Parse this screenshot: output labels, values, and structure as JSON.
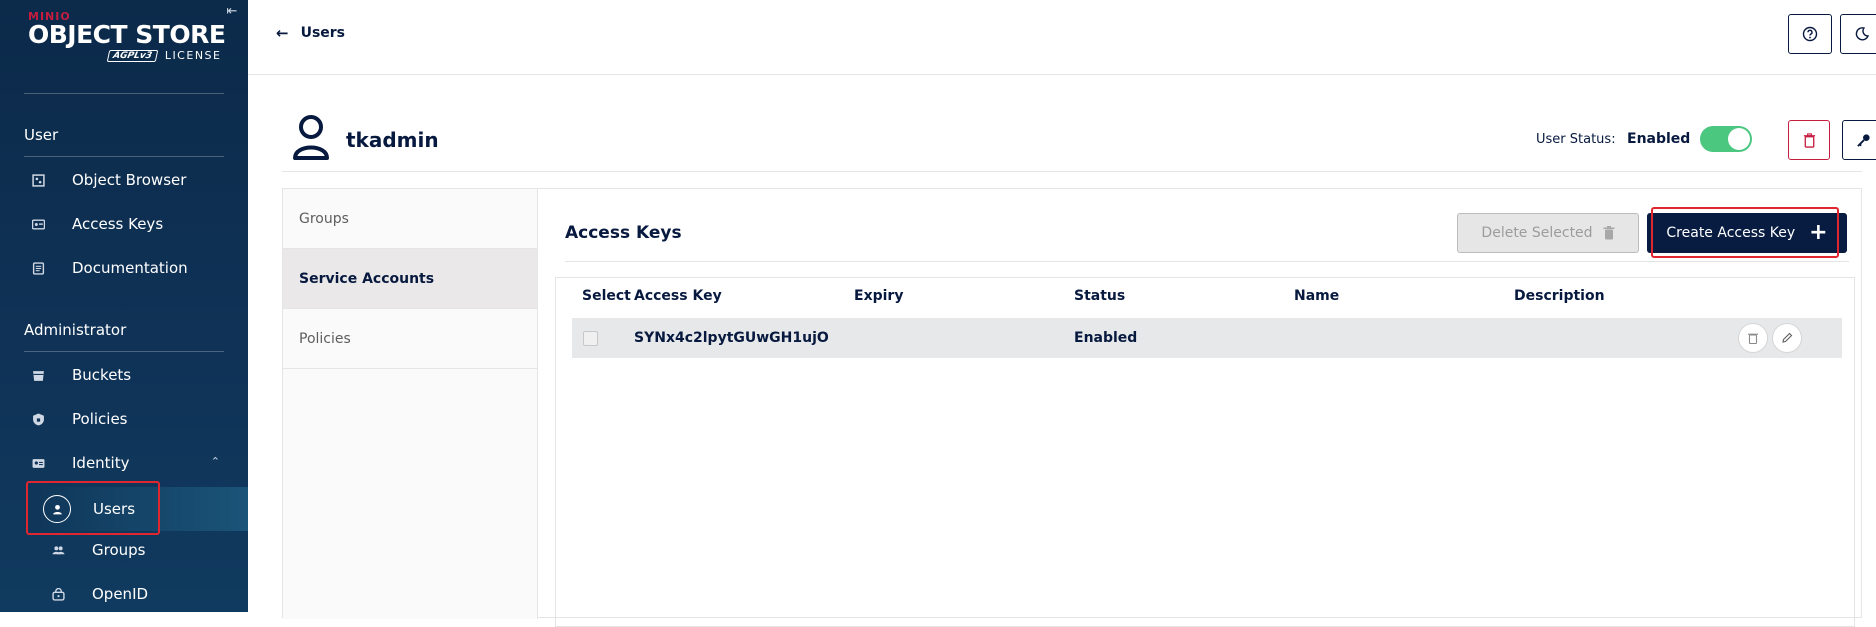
{
  "brand": {
    "logo_top": "MINIO",
    "product": "OBJECT STORE",
    "license_badge": "AGPLv3",
    "license": "LICENSE"
  },
  "sidebar": {
    "user_section": "User",
    "user_items": [
      {
        "label": "Object Browser",
        "icon": "object-browser-icon"
      },
      {
        "label": "Access Keys",
        "icon": "access-keys-icon"
      },
      {
        "label": "Documentation",
        "icon": "documentation-icon"
      }
    ],
    "admin_section": "Administrator",
    "admin_items": [
      {
        "label": "Buckets",
        "icon": "buckets-icon"
      },
      {
        "label": "Policies",
        "icon": "policies-icon"
      },
      {
        "label": "Identity",
        "icon": "identity-icon"
      }
    ],
    "identity_items": [
      {
        "label": "Users",
        "icon": "user-circle-icon",
        "active": true
      },
      {
        "label": "Groups",
        "icon": "groups-icon"
      },
      {
        "label": "OpenID",
        "icon": "openid-icon"
      }
    ]
  },
  "topbar": {
    "back_label": "Users",
    "back_arrow": "←"
  },
  "user": {
    "name": "tkadmin",
    "status_label": "User Status:",
    "status_value": "Enabled",
    "enabled": true
  },
  "tabs": [
    {
      "label": "Groups",
      "active": false
    },
    {
      "label": "Service Accounts",
      "active": true
    },
    {
      "label": "Policies",
      "active": false
    }
  ],
  "access_keys": {
    "title": "Access Keys",
    "delete_selected": "Delete Selected",
    "create_label": "Create Access Key",
    "create_icon": "+",
    "columns": [
      "Select",
      "Access Key",
      "Expiry",
      "Status",
      "Name",
      "Description"
    ],
    "rows": [
      {
        "access_key": "SYNx4c2lpytGUwGH1ujO",
        "expiry": "",
        "status": "Enabled",
        "name": "",
        "description": ""
      }
    ]
  },
  "colors": {
    "sidebar": "#0c2a4a",
    "primary": "#081c42",
    "danger": "#c51c3f",
    "toggle_on": "#4cc77f",
    "highlight": "#e0262e"
  }
}
